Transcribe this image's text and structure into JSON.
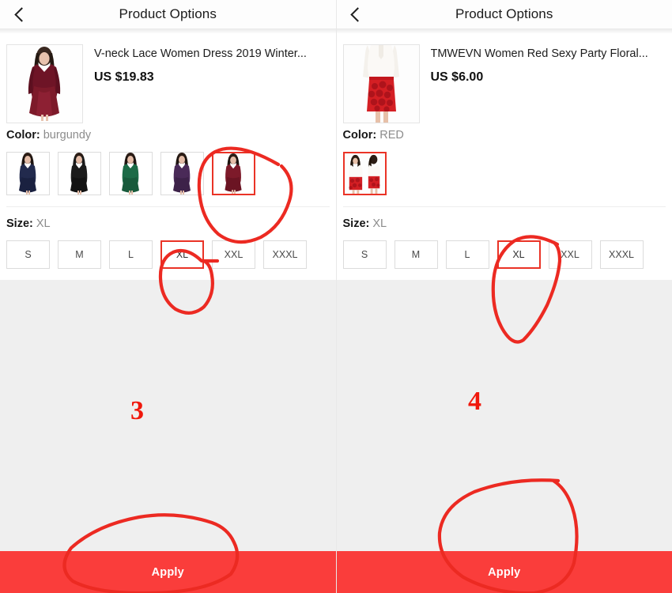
{
  "panels": [
    {
      "header": {
        "title": "Product Options",
        "back_icon": "chevron-left-icon"
      },
      "product": {
        "title": "V-neck Lace Women Dress 2019 Winter...",
        "price": "US $19.83",
        "thumb_alt": "burgundy-lace-dress-thumbnail"
      },
      "color": {
        "label": "Color:",
        "value": "burgundy",
        "swatches": [
          {
            "name": "navy",
            "hex": "#222a4d",
            "selected": false
          },
          {
            "name": "black",
            "hex": "#1b1b1b",
            "selected": false
          },
          {
            "name": "green",
            "hex": "#1c6b47",
            "selected": false
          },
          {
            "name": "purple",
            "hex": "#4a2a58",
            "selected": false
          },
          {
            "name": "burgundy",
            "hex": "#7d1a2a",
            "selected": true
          }
        ]
      },
      "size": {
        "label": "Size:",
        "value": "XL",
        "options": [
          {
            "label": "S",
            "selected": false
          },
          {
            "label": "M",
            "selected": false
          },
          {
            "label": "L",
            "selected": false
          },
          {
            "label": "XL",
            "selected": true
          },
          {
            "label": "XXL",
            "selected": false
          },
          {
            "label": "XXXL",
            "selected": false
          }
        ]
      },
      "apply": {
        "label": "Apply"
      },
      "annotation_number": "3"
    },
    {
      "header": {
        "title": "Product Options",
        "back_icon": "chevron-left-icon"
      },
      "product": {
        "title": "TMWEVN Women Red Sexy Party Floral...",
        "price": "US $6.00",
        "thumb_alt": "red-lace-pencil-skirt-thumbnail"
      },
      "color": {
        "label": "Color:",
        "value": "RED",
        "swatches": [
          {
            "name": "red",
            "hex": "#d41f24",
            "selected": true
          }
        ]
      },
      "size": {
        "label": "Size:",
        "value": "XL",
        "options": [
          {
            "label": "S",
            "selected": false
          },
          {
            "label": "M",
            "selected": false
          },
          {
            "label": "L",
            "selected": false
          },
          {
            "label": "XL",
            "selected": true
          },
          {
            "label": "XXL",
            "selected": false
          },
          {
            "label": "XXXL",
            "selected": false
          }
        ]
      },
      "apply": {
        "label": "Apply"
      },
      "annotation_number": "4"
    }
  ],
  "colors": {
    "accent_red": "#ea3326",
    "apply_bar": "#fa3d3b",
    "annotation": "#f0180c",
    "page_background": "#efefef",
    "card_background": "#ffffff"
  }
}
